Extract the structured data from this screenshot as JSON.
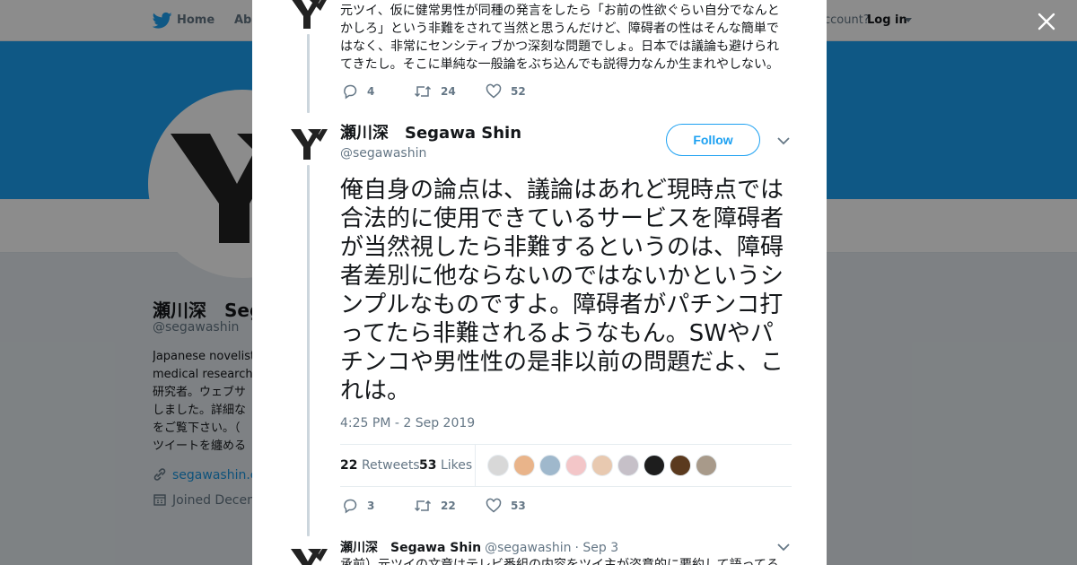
{
  "nav": {
    "home": "Home",
    "about": "Abo",
    "account_prompt": "ccount?",
    "login": "Log in"
  },
  "profile": {
    "name": "瀬川深　Seg",
    "handle": "@segawashin",
    "bio_lines": [
      "Japanese novelist",
      "medical researche",
      "研究者。ウェブサ",
      "しました。詳細な",
      "をご覧下さい。（",
      "ツイートを纏める"
    ],
    "link": "segawashin.co",
    "joined": "Joined Decem"
  },
  "prev_tweet": {
    "text": "元ツイ、仮に健常男性が同種の発言をしたら「お前の性欲ぐらい自分でなんとかしろ」という非難をされて当然と思うんだけど、障碍者の性はそんな簡単ではなく、非常にセンシティブかつ深刻な問題でしょ。日本では議論も避けられてきたし。そこに単純な一般論をぶち込んでも説得力なんか生まれやしない。",
    "replies": "4",
    "retweets": "24",
    "likes": "52"
  },
  "main_tweet": {
    "name": "瀬川深　Segawa Shin",
    "handle": "@segawashin",
    "follow_label": "Follow",
    "text": "俺自身の論点は、議論はあれど現時点では合法的に使用できているサービスを障碍者が当然視したら非難するというのは、障碍者差別に他ならないのではないかというシンプルなものですよ。障碍者がパチンコ打ってたら非難されるようなもん。SWやパチンコや男性性の是非以前の問題だよ、これは。",
    "timestamp": "4:25 PM - 2 Sep 2019",
    "retweet_count": "22",
    "retweet_label": "Retweets",
    "like_count": "53",
    "like_label": "Likes",
    "replies": "3",
    "retweets": "22",
    "likes": "53"
  },
  "next_tweet": {
    "name": "瀬川深　Segawa Shin",
    "handle": "@segawashin",
    "date": "· Sep 3",
    "text": "承前）元ツイの文章はテレビ番組の内容をツイ主が恣意的に要約して語ってる"
  },
  "colors": {
    "brand": "#1da1f2",
    "link": "#1b95e0",
    "muted": "#657786",
    "text": "#14171a",
    "thread_line": "#ccd6dd"
  },
  "liker_colors": [
    "#d8d8d8",
    "#e9b48a",
    "#9fb8cc",
    "#f3c6c8",
    "#e8c9b0",
    "#c6c0c8",
    "#1d1d1d",
    "#5b3a1e",
    "#a89a8a"
  ],
  "icons": {
    "close": "close-icon",
    "logo": "twitter-bird-icon",
    "reply": "reply-icon",
    "retweet": "retweet-icon",
    "like": "heart-icon",
    "more": "chevron-down-icon"
  }
}
